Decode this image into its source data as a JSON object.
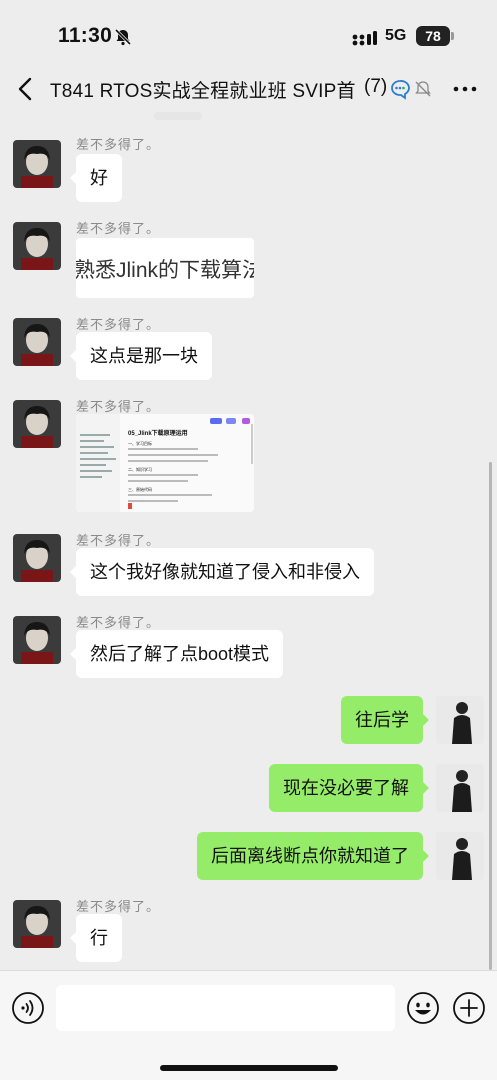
{
  "status_bar": {
    "time": "11:30",
    "network": "5G",
    "battery": "78",
    "icons": [
      "bell-off-icon",
      "signal-icon"
    ]
  },
  "header": {
    "title": "T841 RTOS实战全程就业班 SVIP首",
    "count": "(7)",
    "icons": [
      "back-icon",
      "ai-assistant-icon",
      "mute-icon",
      "more-icon"
    ]
  },
  "messages": [
    {
      "sender": "差不多得了。",
      "text": "好",
      "side": "in"
    },
    {
      "sender": "差不多得了。",
      "image_caption": "熟悉Jlink的下载算法",
      "side": "in",
      "kind": "image-text"
    },
    {
      "sender": "差不多得了。",
      "text": "这点是那一块",
      "side": "in"
    },
    {
      "sender": "差不多得了。",
      "side": "in",
      "kind": "screenshot",
      "screenshot": {
        "heading": "05_Jlink下载原理运用",
        "sections": [
          "一、学习目标",
          "二、知识学习",
          "三、原始代码"
        ]
      }
    },
    {
      "sender": "差不多得了。",
      "text": "这个我好像就知道了侵入和非侵入",
      "side": "in"
    },
    {
      "sender": "差不多得了。",
      "text": "然后了解了点boot模式",
      "side": "in"
    },
    {
      "text": "往后学",
      "side": "out"
    },
    {
      "text": "现在没必要了解",
      "side": "out"
    },
    {
      "text": "后面离线断点你就知道了",
      "side": "out"
    },
    {
      "sender": "差不多得了。",
      "text": "行",
      "side": "in"
    }
  ],
  "input_bar": {
    "placeholder": "",
    "icons": [
      "voice-icon",
      "emoji-icon",
      "plus-icon"
    ]
  },
  "colors": {
    "background": "#ededed",
    "bubble_in": "#ffffff",
    "bubble_out": "#95ec69",
    "sender_text": "#8a8a8a"
  }
}
